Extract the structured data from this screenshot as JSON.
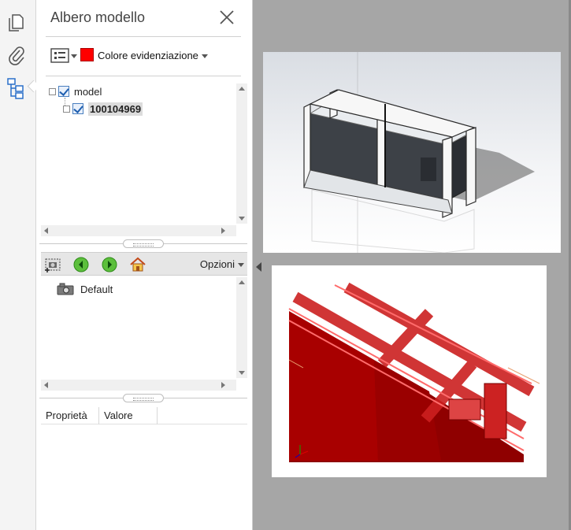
{
  "rail": {
    "icons": [
      "pages-icon",
      "attachment-icon",
      "model-tree-icon"
    ]
  },
  "panel": {
    "title": "Albero modello",
    "color_highlight_label": "Colore evidenziazione",
    "highlight_color": "#ff0000",
    "tree": [
      {
        "label": "model",
        "checked": true,
        "selected": false
      },
      {
        "label": "100104969",
        "checked": true,
        "selected": true
      }
    ],
    "views_toolbar": {
      "options_label": "Opzioni"
    },
    "views": [
      {
        "label": "Default"
      }
    ],
    "properties": {
      "col_property": "Proprietà",
      "col_value": "Valore"
    }
  },
  "document": {
    "pages": [
      {
        "content": "3d-model-preview"
      },
      {
        "content": "3d-model-highlighted-red"
      }
    ]
  }
}
